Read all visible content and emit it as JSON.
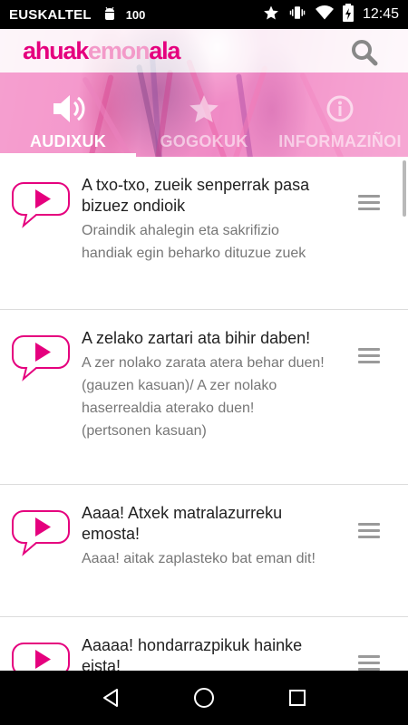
{
  "status_bar": {
    "carrier": "EUSKALTEL",
    "battery_level": "100",
    "time": "12:45"
  },
  "app": {
    "logo_part1": "ahuak",
    "logo_part2": "emon",
    "logo_part3": "ala",
    "brand_color": "#e5007e",
    "brand_light_color": "#f39ac9"
  },
  "tabs": [
    {
      "label": "AUDIXUK",
      "icon": "speaker-icon",
      "active": true
    },
    {
      "label": "GOGOKUK",
      "icon": "star-icon",
      "active": false
    },
    {
      "label": "INFORMAZIÑOI",
      "icon": "info-icon",
      "active": false
    }
  ],
  "items": [
    {
      "title": "A txo-txo, zueik senperrak pasa bizuez ondioik",
      "desc": "Oraindik ahalegin eta sakrifizio handiak egin beharko dituzue zuek"
    },
    {
      "title": "A zelako zartari ata bihir daben!",
      "desc": "A zer nolako zarata atera behar duen! (gauzen kasuan)/ A zer nolako haserrealdia aterako duen! (pertsonen kasuan)"
    },
    {
      "title": "Aaaa! Atxek matralazurreku emosta!",
      "desc": "Aaaa! aitak zaplasteko bat eman dit!"
    },
    {
      "title": "Aaaaa! hondarrazpikuk hainke eista!",
      "desc": ""
    }
  ]
}
